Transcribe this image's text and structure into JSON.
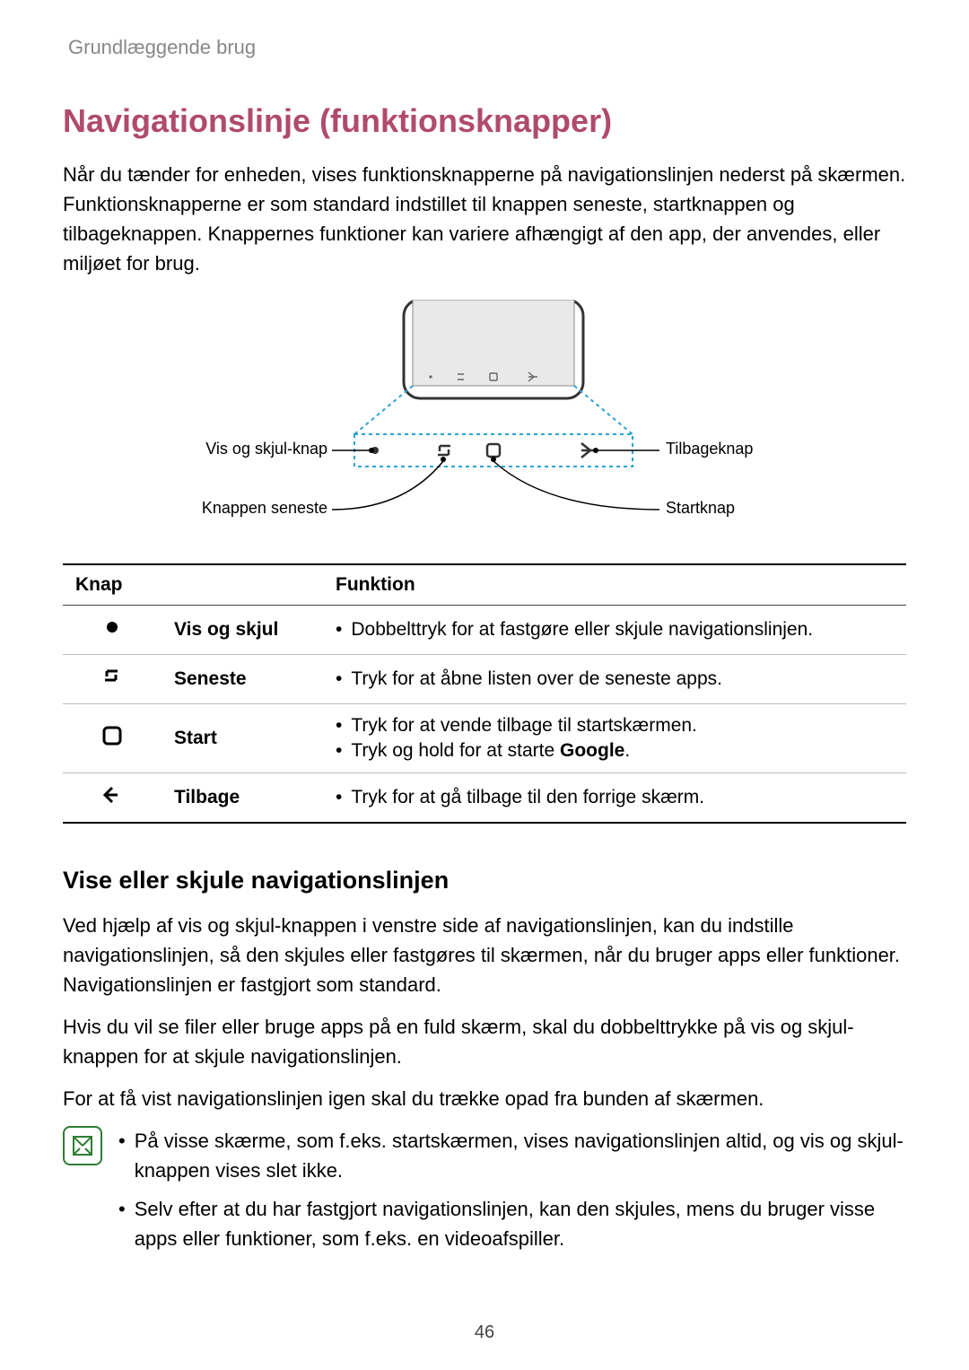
{
  "breadcrumb": "Grundlæggende brug",
  "h1": "Navigationslinje (funktionsknapper)",
  "intro": "Når du tænder for enheden, vises funktionsknapperne på navigationslinjen nederst på skærmen. Funktionsknapperne er som standard indstillet til knappen seneste, startknappen og tilbageknappen. Knappernes funktioner kan variere afhængigt af den app, der anvendes, eller miljøet for brug.",
  "diagram": {
    "labels": {
      "show_hide": "Vis og skjul-knap",
      "recents": "Knappen seneste",
      "back": "Tilbageknap",
      "home": "Startknap"
    }
  },
  "table": {
    "hdr_btn": "Knap",
    "hdr_func": "Funktion",
    "rows": [
      {
        "name": "Vis og skjul",
        "funcs": [
          "Dobbelttryk for at fastgøre eller skjule navigationslinjen."
        ]
      },
      {
        "name": "Seneste",
        "funcs": [
          "Tryk for at åbne listen over de seneste apps."
        ]
      },
      {
        "name": "Start",
        "funcs": [
          "Tryk for at vende tilbage til startskærmen.",
          "Tryk og hold for at starte Google."
        ],
        "bold_last_word": "Google"
      },
      {
        "name": "Tilbage",
        "funcs": [
          "Tryk for at gå tilbage til den forrige skærm."
        ]
      }
    ]
  },
  "h2": "Vise eller skjule navigationslinjen",
  "p1": "Ved hjælp af vis og skjul-knappen i venstre side af navigationslinjen, kan du indstille navigationslinjen, så den skjules eller fastgøres til skærmen, når du bruger apps eller funktioner. Navigationslinjen er fastgjort som standard.",
  "p2": "Hvis du vil se filer eller bruge apps på en fuld skærm, skal du dobbelttrykke på vis og skjul-knappen for at skjule navigationslinjen.",
  "p3": "For at få vist navigationslinjen igen skal du trække opad fra bunden af skærmen.",
  "notes": [
    "På visse skærme, som f.eks. startskærmen, vises navigationslinjen altid, og vis og skjul-knappen vises slet ikke.",
    "Selv efter at du har fastgjort navigationslinjen, kan den skjules, mens du bruger visse apps eller funktioner, som f.eks. en videoafspiller."
  ],
  "page_num": "46"
}
